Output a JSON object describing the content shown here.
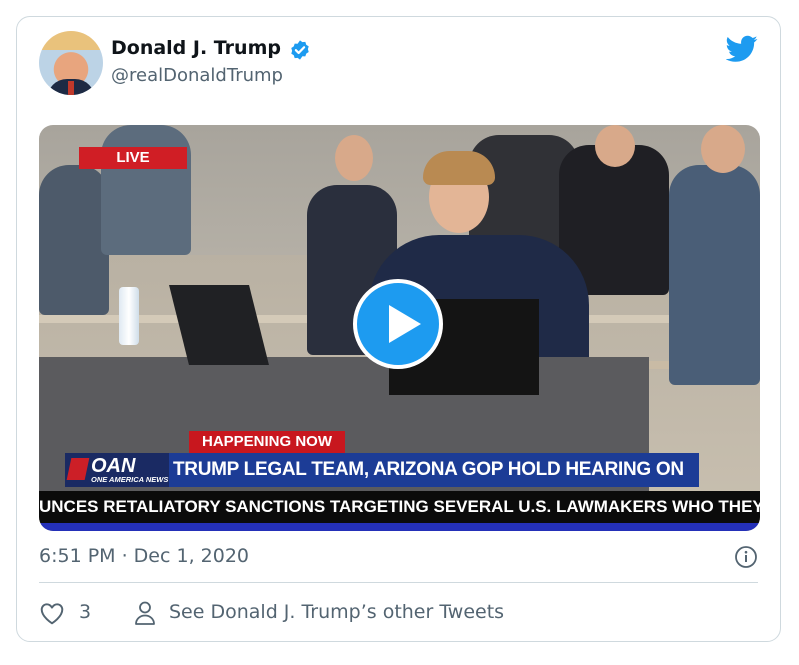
{
  "tweet": {
    "display_name": "Donald J. Trump",
    "handle": "@realDonaldTrump",
    "timestamp": "6:51 PM · Dec 1, 2020",
    "like_count": "3",
    "other_tweets_label": "See Donald J. Trump’s other Tweets"
  },
  "video": {
    "live_label": "LIVE",
    "happening_label": "HAPPENING NOW",
    "network_logo": "OAN",
    "network_name": "ONE AMERICA NEWS",
    "headline": "TRUMP LEGAL TEAM, ARIZONA GOP HOLD HEARING ON ELECTION FRAUD",
    "ticker": "UNCES RETALIATORY SANCTIONS TARGETING SEVERAL U.S. LAWMAKERS WHO THEY"
  },
  "icons": {
    "verified": "verified-badge-icon",
    "brand": "twitter-bird-icon",
    "play": "play-icon",
    "info": "info-icon",
    "like": "heart-icon",
    "profile": "person-icon"
  },
  "colors": {
    "twitter_blue": "#1d9bf0",
    "secondary_text": "#536471",
    "live_red": "#d01e25",
    "oan_blue": "#1c3c96"
  }
}
